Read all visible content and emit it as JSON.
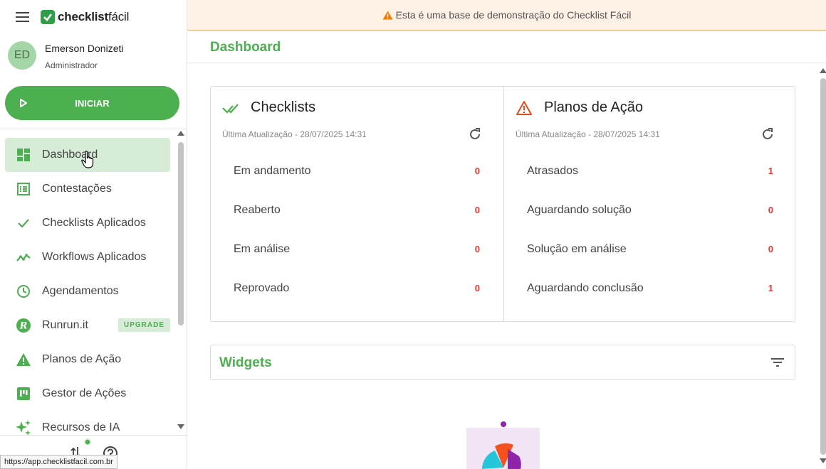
{
  "brand": {
    "name_bold": "checklist",
    "name_light": "fácil"
  },
  "user": {
    "initials": "ED",
    "name": "Emerson Donizeti",
    "role": "Administrador"
  },
  "start_button": {
    "label": "INICIAR"
  },
  "nav": [
    {
      "label": "Dashboard",
      "icon": "dashboard-icon",
      "active": true
    },
    {
      "label": "Contestações",
      "icon": "list-icon"
    },
    {
      "label": "Checklists Aplicados",
      "icon": "check-icon"
    },
    {
      "label": "Workflows Aplicados",
      "icon": "trend-icon"
    },
    {
      "label": "Agendamentos",
      "icon": "clock-icon"
    },
    {
      "label": "Runrun.it",
      "icon": "runrun-icon",
      "badge": "UPGRADE"
    },
    {
      "label": "Planos de Ação",
      "icon": "warning-icon"
    },
    {
      "label": "Gestor de Ações",
      "icon": "kanban-icon"
    },
    {
      "label": "Recursos de IA",
      "icon": "sparkle-icon"
    }
  ],
  "status_url": "https://app.checklistfacil.com.br",
  "banner": {
    "text": "Esta é uma base de demonstração do Checklist Fácil"
  },
  "page": {
    "title": "Dashboard"
  },
  "checklists": {
    "title": "Checklists",
    "updated": "Última Atualização - 28/07/2025 14:31",
    "rows": [
      {
        "label": "Em andamento",
        "value": "0"
      },
      {
        "label": "Reaberto",
        "value": "0"
      },
      {
        "label": "Em análise",
        "value": "0"
      },
      {
        "label": "Reprovado",
        "value": "0"
      }
    ]
  },
  "action_plans": {
    "title": "Planos de Ação",
    "updated": "Última Atualização - 28/07/2025 14:31",
    "rows": [
      {
        "label": "Atrasados",
        "value": "1"
      },
      {
        "label": "Aguardando solução",
        "value": "0"
      },
      {
        "label": "Solução em análise",
        "value": "0"
      },
      {
        "label": "Aguardando conclusão",
        "value": "1"
      }
    ]
  },
  "widgets": {
    "title": "Widgets"
  },
  "colors": {
    "brand_green": "#4caf50",
    "alert_red": "#e53935",
    "banner_bg": "#fdf1e6",
    "warning_orange": "#f57c00"
  }
}
